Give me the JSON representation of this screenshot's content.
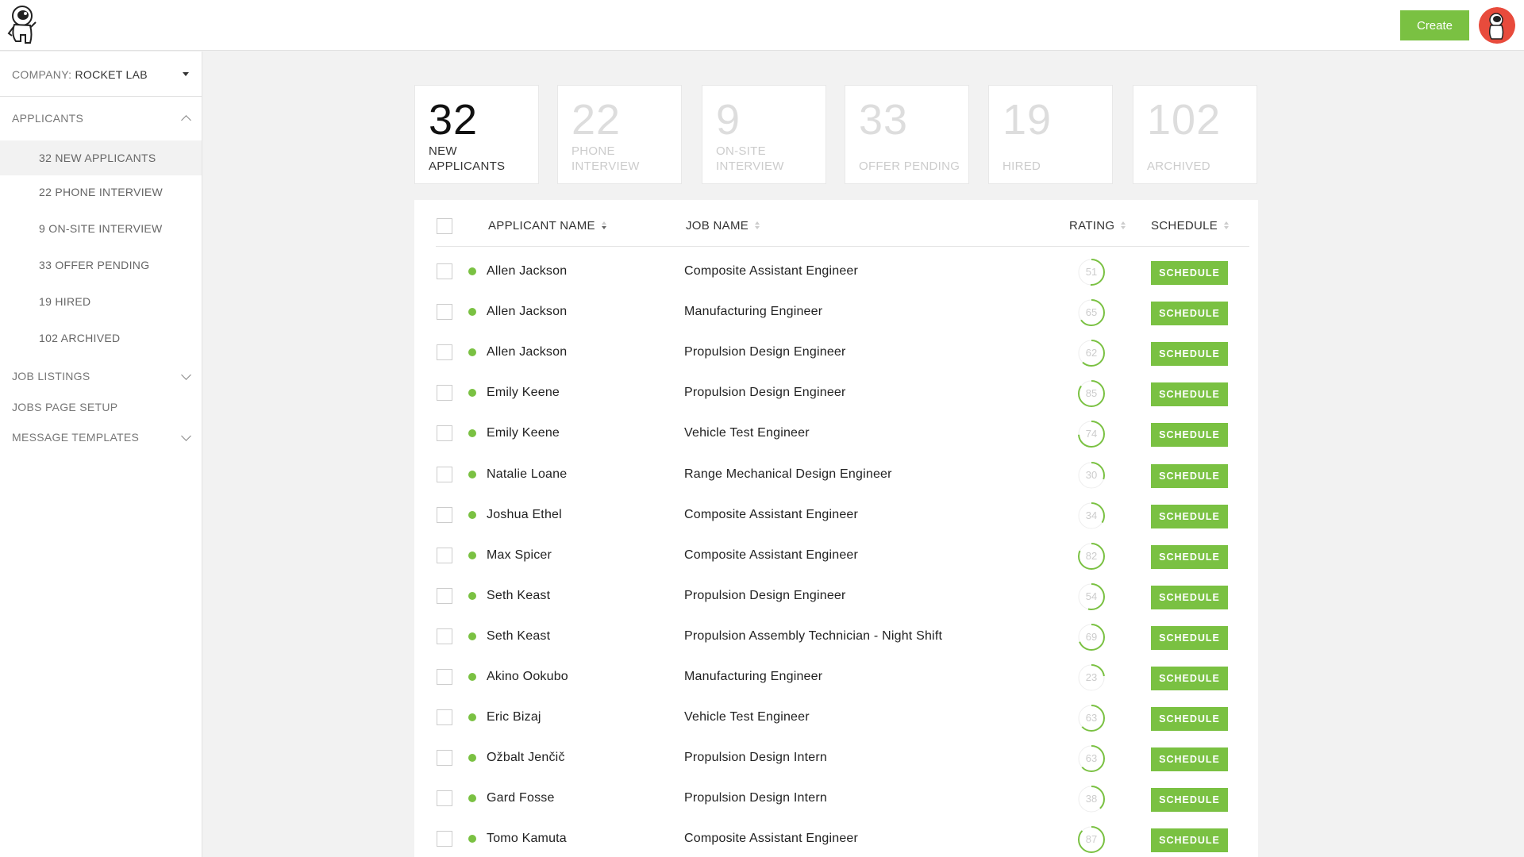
{
  "header": {
    "create_label": "Create",
    "accent_color": "#7ac142",
    "logo_icon": "astronaut-logo-icon",
    "avatar_icon": "astronaut-avatar-icon"
  },
  "sidebar": {
    "company_label": "COMPANY:",
    "company_name": "ROCKET LAB",
    "applicants_label": "APPLICANTS",
    "applicant_stages": [
      "32 NEW APPLICANTS",
      "22 PHONE INTERVIEW",
      "9 ON-SITE INTERVIEW",
      "33 OFFER PENDING",
      "19 HIRED",
      "102 ARCHIVED"
    ],
    "active_stage": "32 NEW APPLICANTS",
    "job_listings_label": "JOB LISTINGS",
    "jobs_page_setup_label": "JOBS PAGE SETUP",
    "message_templates_label": "MESSAGE TEMPLATES"
  },
  "stats": [
    {
      "count": "32",
      "label": "NEW APPLICANTS",
      "active": true
    },
    {
      "count": "22",
      "label": "PHONE INTERVIEW",
      "active": false
    },
    {
      "count": "9",
      "label": "ON-SITE INTERVIEW",
      "active": false
    },
    {
      "count": "33",
      "label": "OFFER PENDING",
      "active": false
    },
    {
      "count": "19",
      "label": "HIRED",
      "active": false
    },
    {
      "count": "102",
      "label": "ARCHIVED",
      "active": false
    }
  ],
  "table": {
    "columns": {
      "applicant_name": "APPLICANT NAME",
      "job_name": "JOB NAME",
      "rating": "RATING",
      "schedule": "SCHEDULE"
    },
    "schedule_label": "SCHEDULE",
    "rows": [
      {
        "name": "Allen Jackson",
        "job": "Composite Assistant Engineer",
        "rating": 51
      },
      {
        "name": "Allen Jackson",
        "job": "Manufacturing Engineer",
        "rating": 65
      },
      {
        "name": "Allen Jackson",
        "job": "Propulsion Design Engineer",
        "rating": 62
      },
      {
        "name": "Emily Keene",
        "job": "Propulsion Design Engineer",
        "rating": 85
      },
      {
        "name": "Emily Keene",
        "job": "Vehicle Test Engineer",
        "rating": 74
      },
      {
        "name": "Natalie Loane",
        "job": "Range Mechanical Design Engineer",
        "rating": 30
      },
      {
        "name": "Joshua Ethel",
        "job": "Composite Assistant Engineer",
        "rating": 34
      },
      {
        "name": "Max Spicer",
        "job": "Composite Assistant Engineer",
        "rating": 82
      },
      {
        "name": "Seth Keast",
        "job": "Propulsion Design Engineer",
        "rating": 54
      },
      {
        "name": "Seth Keast",
        "job": "Propulsion Assembly Technician - Night Shift",
        "rating": 69
      },
      {
        "name": "Akino Ookubo",
        "job": "Manufacturing  Engineer",
        "rating": 23
      },
      {
        "name": "Eric Bizaj",
        "job": "Vehicle Test Engineer",
        "rating": 63
      },
      {
        "name": "Ožbalt Jenčič",
        "job": "Propulsion Design Intern",
        "rating": 63
      },
      {
        "name": "Gard Fosse",
        "job": "Propulsion Design Intern",
        "rating": 38
      },
      {
        "name": "Tomo Kamuta",
        "job": "Composite Assistant Engineer",
        "rating": 87
      }
    ]
  }
}
